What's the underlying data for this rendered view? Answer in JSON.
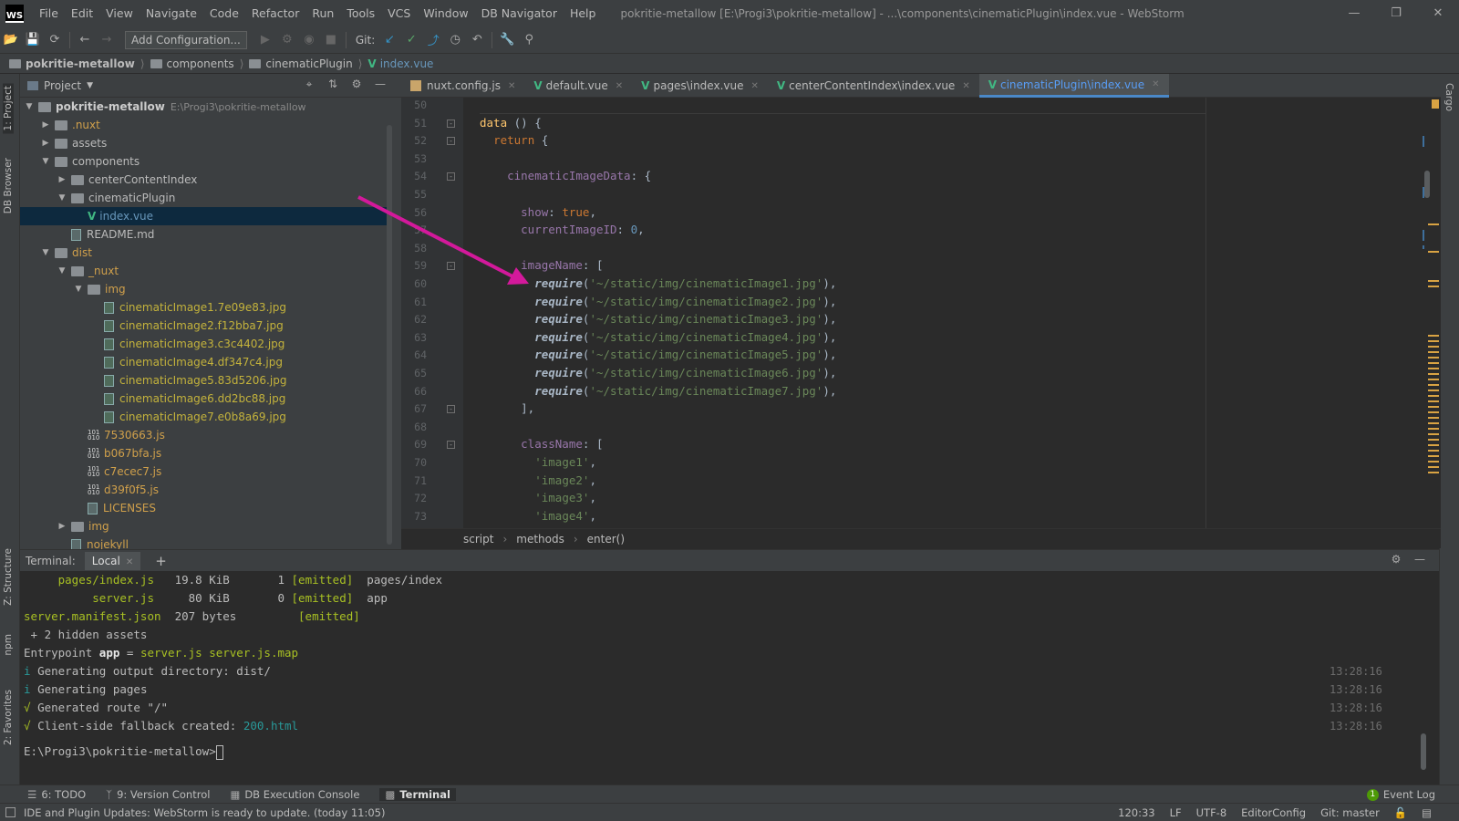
{
  "app": {
    "logo": "WS",
    "window_title": "pokritie-metallow [E:\\Progi3\\pokritie-metallow] - ...\\components\\cinematicPlugin\\index.vue - WebStorm",
    "menu": [
      "File",
      "Edit",
      "View",
      "Navigate",
      "Code",
      "Refactor",
      "Run",
      "Tools",
      "VCS",
      "Window",
      "DB Navigator",
      "Help"
    ]
  },
  "toolbar": {
    "add_configuration": "Add Configuration...",
    "git_label": "Git:"
  },
  "breadcrumb": [
    "pokritie-metallow",
    "components",
    "cinematicPlugin",
    "index.vue"
  ],
  "left_strip": {
    "project": "1: Project",
    "db_browser": "DB Browser",
    "structure": "Z: Structure",
    "npm": "npm",
    "favorites": "2: Favorites"
  },
  "right_strip": {
    "cargo": "Cargo"
  },
  "project_panel": {
    "title": "Project",
    "root_name": "pokritie-metallow",
    "root_path": "E:\\Progi3\\pokritie-metallow",
    "nodes": [
      {
        "label": ".nuxt",
        "depth": 1,
        "kind": "folder",
        "state": "collapsed",
        "color": "excluded"
      },
      {
        "label": "assets",
        "depth": 1,
        "kind": "folder",
        "state": "collapsed",
        "color": "normal"
      },
      {
        "label": "components",
        "depth": 1,
        "kind": "folder",
        "state": "expanded",
        "color": "normal"
      },
      {
        "label": "centerContentIndex",
        "depth": 2,
        "kind": "folder",
        "state": "collapsed",
        "color": "normal"
      },
      {
        "label": "cinematicPlugin",
        "depth": 2,
        "kind": "folder",
        "state": "expanded",
        "color": "normal"
      },
      {
        "label": "index.vue",
        "depth": 3,
        "kind": "vue",
        "state": "none",
        "color": "blue",
        "selected": true
      },
      {
        "label": "README.md",
        "depth": 2,
        "kind": "file",
        "state": "none",
        "color": "normal"
      },
      {
        "label": "dist",
        "depth": 1,
        "kind": "folder",
        "state": "expanded",
        "color": "excluded"
      },
      {
        "label": "_nuxt",
        "depth": 2,
        "kind": "folder",
        "state": "expanded",
        "color": "excluded"
      },
      {
        "label": "img",
        "depth": 3,
        "kind": "folder",
        "state": "expanded",
        "color": "excluded"
      },
      {
        "label": "cinematicImage1.7e09e83.jpg",
        "depth": 4,
        "kind": "image",
        "state": "none",
        "color": "img"
      },
      {
        "label": "cinematicImage2.f12bba7.jpg",
        "depth": 4,
        "kind": "image",
        "state": "none",
        "color": "img"
      },
      {
        "label": "cinematicImage3.c3c4402.jpg",
        "depth": 4,
        "kind": "image",
        "state": "none",
        "color": "img"
      },
      {
        "label": "cinematicImage4.df347c4.jpg",
        "depth": 4,
        "kind": "image",
        "state": "none",
        "color": "img"
      },
      {
        "label": "cinematicImage5.83d5206.jpg",
        "depth": 4,
        "kind": "image",
        "state": "none",
        "color": "img"
      },
      {
        "label": "cinematicImage6.dd2bc88.jpg",
        "depth": 4,
        "kind": "image",
        "state": "none",
        "color": "img"
      },
      {
        "label": "cinematicImage7.e0b8a69.jpg",
        "depth": 4,
        "kind": "image",
        "state": "none",
        "color": "img"
      },
      {
        "label": "7530663.js",
        "depth": 3,
        "kind": "js",
        "state": "none",
        "color": "excluded"
      },
      {
        "label": "b067bfa.js",
        "depth": 3,
        "kind": "js",
        "state": "none",
        "color": "excluded"
      },
      {
        "label": "c7ecec7.js",
        "depth": 3,
        "kind": "js",
        "state": "none",
        "color": "excluded"
      },
      {
        "label": "d39f0f5.js",
        "depth": 3,
        "kind": "js",
        "state": "none",
        "color": "excluded"
      },
      {
        "label": "LICENSES",
        "depth": 3,
        "kind": "file",
        "state": "none",
        "color": "excluded"
      },
      {
        "label": "img",
        "depth": 2,
        "kind": "folder",
        "state": "collapsed",
        "color": "excluded"
      },
      {
        "label": "nojekyll",
        "depth": 2,
        "kind": "file",
        "state": "none",
        "color": "excluded"
      }
    ]
  },
  "editor_tabs": [
    {
      "label": "nuxt.config.js",
      "icon": "js",
      "active": false
    },
    {
      "label": "default.vue",
      "icon": "vue",
      "active": false
    },
    {
      "label": "pages\\index.vue",
      "icon": "vue",
      "active": false
    },
    {
      "label": "centerContentIndex\\index.vue",
      "icon": "vue",
      "active": false
    },
    {
      "label": "cinematicPlugin\\index.vue",
      "icon": "vue",
      "active": true
    }
  ],
  "code": {
    "line_numbers": [
      "50",
      "51",
      "52",
      "53",
      "54",
      "55",
      "56",
      "57",
      "58",
      "59",
      "60",
      "61",
      "62",
      "63",
      "64",
      "65",
      "66",
      "67",
      "68",
      "69",
      "70",
      "71",
      "72",
      "73"
    ],
    "images": [
      "'~/static/img/cinematicImage1.jpg'",
      "'~/static/img/cinematicImage2.jpg'",
      "'~/static/img/cinematicImage3.jpg'",
      "'~/static/img/cinematicImage4.jpg'",
      "'~/static/img/cinematicImage5.jpg'",
      "'~/static/img/cinematicImage6.jpg'",
      "'~/static/img/cinematicImage7.jpg'"
    ],
    "classes": [
      "'image1'",
      "'image2'",
      "'image3'",
      "'image4'"
    ],
    "kw_data": "data",
    "kw_return": "return",
    "kw_true": "true",
    "kw_require": "require",
    "p_cinematic": "cinematicImageData",
    "p_show": "show",
    "p_current": "currentImageID",
    "p_imagename": "imageName",
    "p_classname": "className",
    "num_zero": "0"
  },
  "editor_breadcrumb": [
    "script",
    "methods",
    "enter()"
  ],
  "terminal": {
    "label": "Terminal:",
    "tab": "Local",
    "lines": [
      {
        "a": "     pages/index.js",
        "b": "   19.8 KiB       1 ",
        "c": "[emitted]",
        "d": "  pages/index"
      },
      {
        "a": "          server.js",
        "b": "     80 KiB       0 ",
        "c": "[emitted]",
        "d": "  app"
      },
      {
        "a": "server.manifest.json",
        "b": "  207 bytes         ",
        "c": "[emitted]",
        "d": ""
      }
    ],
    "hidden_assets": " + 2 hidden assets",
    "entry_prefix": "Entrypoint ",
    "entry_app": "app",
    "entry_eq": " = ",
    "entry_files": "server.js server.js.map",
    "info1": "Generating output directory: dist/",
    "info2": "Generating pages",
    "ok1": "Generated route \"/\"",
    "ok2_prefix": "Client-side fallback created: ",
    "ok2_file": "200.html",
    "info_mark": "i",
    "ok_mark": "√",
    "timestamps": [
      "13:28:16",
      "13:28:16",
      "13:28:16",
      "13:28:16"
    ],
    "prompt": "E:\\Progi3\\pokritie-metallow>"
  },
  "bottom_tabs": [
    {
      "label": "6: TODO",
      "active": false
    },
    {
      "label": "9: Version Control",
      "active": false
    },
    {
      "label": "DB Execution Console",
      "active": false
    },
    {
      "label": "Terminal",
      "active": true
    }
  ],
  "event_log": {
    "count": "1",
    "label": "Event Log"
  },
  "status": {
    "message": "IDE and Plugin Updates: WebStorm is ready to update. (today 11:05)",
    "position": "120:33",
    "line_sep": "LF",
    "encoding": "UTF-8",
    "editorconfig": "EditorConfig",
    "git": "Git: master"
  },
  "colors": {
    "accent": "#4a88c7",
    "vue": "#41b883",
    "pointer_arrow": "#d3199b"
  }
}
